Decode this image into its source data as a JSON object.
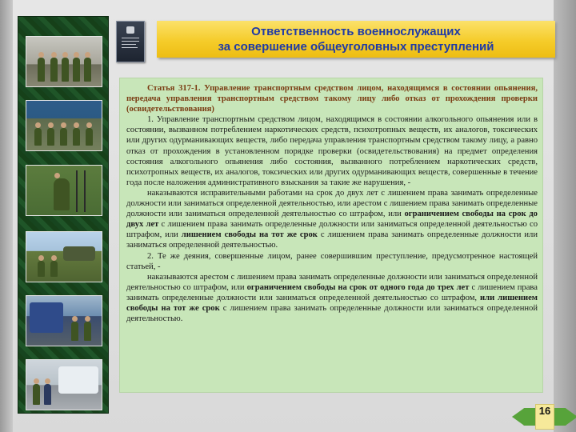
{
  "slide": {
    "title_line1": "Ответственность  военнослужащих",
    "title_line2": "за совершение общеуголовных преступлений",
    "page_number": "16"
  },
  "article": {
    "heading": "Статья 317-1. Управление транспортным средством лицом, находящимся в состоянии опьянения, передача управления транспортным средством такому лицу либо отказ от прохождения проверки (освидетельствования)",
    "p1": "1. Управление транспортным средством лицом, находящимся в состоянии алкогольного опьянения или в состоянии, вызванном потреблением наркотических средств, психотропных веществ, их аналогов, токсических или других одурманивающих веществ, либо передача управления транспортным средством такому лицу, а равно отказ от прохождения в установленном порядке проверки (освидетельствования) на предмет определения состояния алкогольного опьянения либо состояния, вызванного потреблением наркотических средств, психотропных веществ, их аналогов, токсических или других одурманивающих веществ, совершенные в течение года после наложения административного взыскания за такие же нарушения, -",
    "p2_a": "наказываются исправительными работами на срок до двух лет с лишением права занимать определенные должности или заниматься определенной деятельностью, или арестом с лишением права занимать определенные должности или заниматься определенной деятельностью со штрафом, или ",
    "p2_b": "ограничением свободы на срок до двух лет",
    "p2_c": " с лишением права занимать определенные должности или заниматься определенной деятельностью со штрафом, или ",
    "p2_d": "лишением свободы на тот же срок",
    "p2_e": " с лишением права занимать определенные должности или заниматься определенной деятельностью.",
    "p3": "2. Те же деяния, совершенные лицом, ранее совершившим преступление, предусмотренное настоящей статьей, -",
    "p4_a": "наказываются арестом с лишением права занимать определенные должности или заниматься определенной деятельностью со штрафом, или ",
    "p4_b": "ограничением свободы на срок от одного года до трех лет",
    "p4_c": " с лишением права занимать определенные должности или заниматься определенной деятельностью со штрафом, ",
    "p4_d": "или лишением свободы на тот же срок",
    "p4_e": " с лишением права занимать определенные должности или заниматься определенной деятельностью."
  },
  "colors": {
    "title_bg": "#f5cc2a",
    "title_text": "#1f3aa6",
    "content_bg": "#c8e6b9",
    "heading_text": "#7a3b12",
    "nav_arrow": "#57a33a",
    "photo_strip": "#1f5528"
  },
  "icons": {
    "prev": "arrow-left-icon",
    "next": "arrow-right-icon",
    "document": "book-cover-icon"
  }
}
